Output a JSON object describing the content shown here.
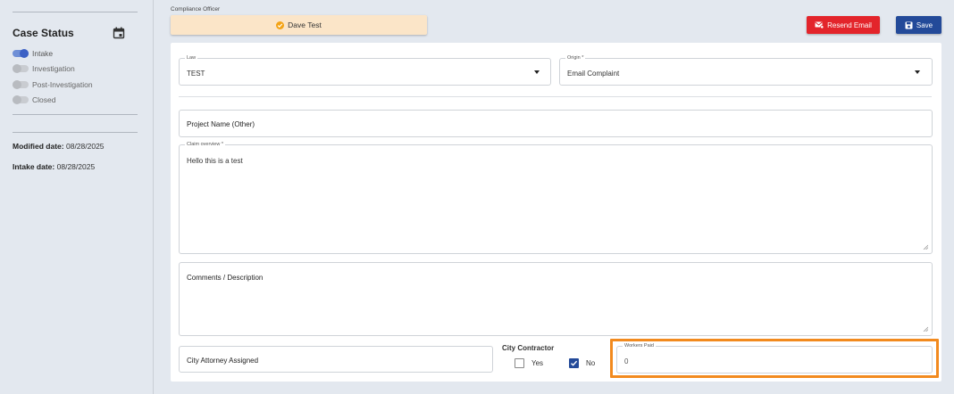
{
  "sidebar": {
    "title": "Case Status",
    "statuses": [
      {
        "label": "Intake",
        "on": true
      },
      {
        "label": "Investigation",
        "on": false
      },
      {
        "label": "Post-Investigation",
        "on": false
      },
      {
        "label": "Closed",
        "on": false
      }
    ],
    "modified_label": "Modified date:",
    "modified_value": "08/28/2025",
    "intake_label": "Intake date:",
    "intake_value": "08/28/2025"
  },
  "header": {
    "officer_label": "Compliance Officer",
    "officer_name": "Dave Test",
    "resend_label": "Resend Email",
    "save_label": "Save"
  },
  "form": {
    "law": {
      "label": "Law",
      "value": "TEST"
    },
    "origin": {
      "label": "Origin *",
      "value": "Email Complaint"
    },
    "project_name": {
      "placeholder": "Project Name (Other)"
    },
    "claim_overview": {
      "label": "Claim overview *",
      "value": "Hello this is a test"
    },
    "comments": {
      "placeholder": "Comments / Description"
    },
    "city_attorney": {
      "placeholder": "City Attorney Assigned"
    },
    "city_contractor": {
      "label": "City Contractor",
      "yes_label": "Yes",
      "no_label": "No",
      "selected": "No"
    },
    "workers_paid": {
      "label": "Workers Paid",
      "value": "0"
    }
  },
  "colors": {
    "resend": "#e3242b",
    "save": "#234a99",
    "officer_bg": "#fbe5c8",
    "highlight": "#f28a1e"
  }
}
